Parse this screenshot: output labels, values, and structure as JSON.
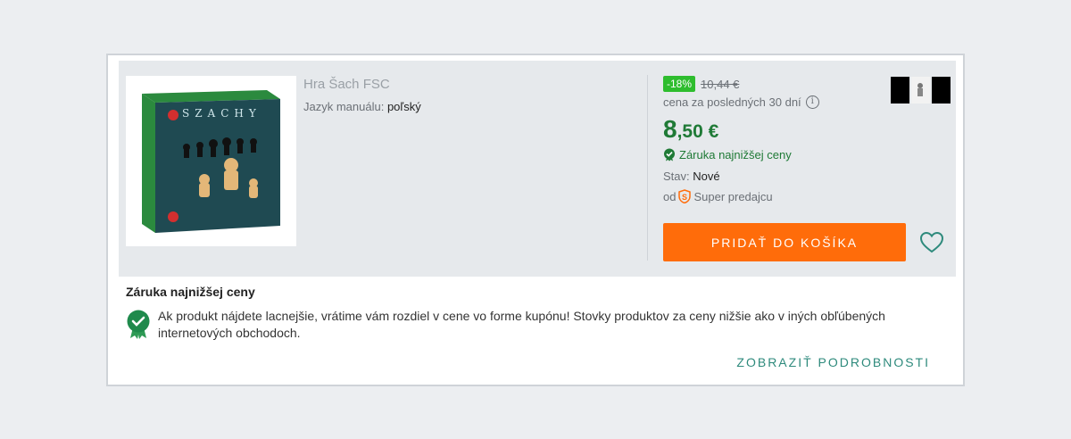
{
  "product": {
    "image_alt": "Hra Šach FSC box",
    "box_text": "SZACHY",
    "title": "Hra Šach FSC",
    "manual_label": "Jazyk manuálu:",
    "manual_value": "poľský"
  },
  "pricing": {
    "discount": "-18%",
    "old_price": "10,44 €",
    "last30_text": "cena za posledných 30 dní",
    "price_main": "8",
    "price_decimal": ",50 €",
    "guarantee_text": "Záruka najnižšej ceny",
    "stav_label": "Stav:",
    "stav_value": "Nové",
    "seller_prefix": "od",
    "seller_name": "Super predajcu",
    "add_to_cart": "PRIDAŤ DO KOŠÍKA"
  },
  "guarantee_section": {
    "title": "Záruka najnižšej ceny",
    "body": "Ak produkt nájdete lacnejšie, vrátime vám rozdiel v cene vo forme kupónu! Stovky produktov za ceny nižšie ako v iných obľúbených internetových obchodoch.",
    "details_link": "ZOBRAZIŤ PODROBNOSTI"
  },
  "colors": {
    "accent_orange": "#ff6c0a",
    "price_green": "#1f7a36",
    "badge_green": "#2ebd2e",
    "link_teal": "#2e8a7c"
  },
  "icons": [
    "info-icon",
    "check-badge-icon",
    "seller-s-icon",
    "heart-icon",
    "guarantee-badge-icon"
  ]
}
